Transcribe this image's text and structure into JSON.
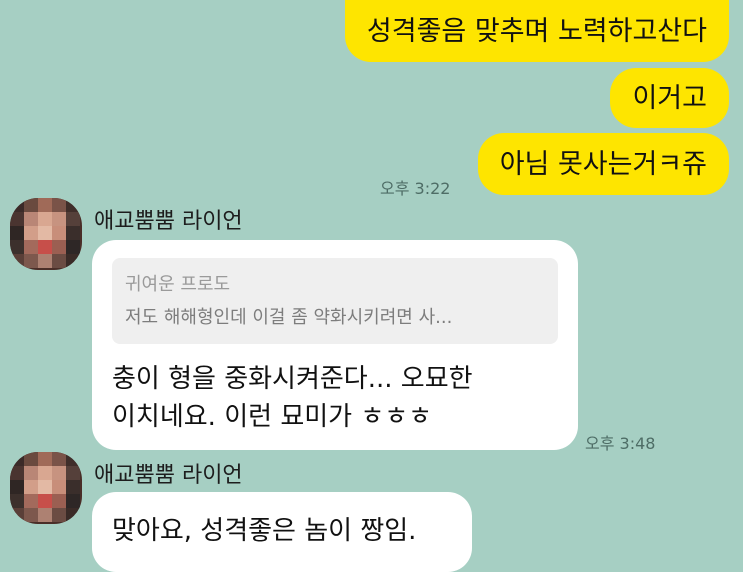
{
  "messages": {
    "sent": [
      {
        "text": "성격좋음 맞추며 노력하고산다"
      },
      {
        "text": "이거고"
      },
      {
        "text": "아님 못사는거ㅋ쥬"
      }
    ],
    "sent_time": "오후 3:22",
    "received_1": {
      "sender": "애교뿜뿜 라이언",
      "reply_to_name": "귀여운 프로도",
      "reply_to_text": "저도 해해형인데 이걸 좀 약화시키려면 사...",
      "lines": [
        "충이 형을 중화시켜준다... 오묘한",
        "이치네요. 이런 묘미가 ㅎㅎㅎ"
      ],
      "time": "오후 3:48"
    },
    "received_2": {
      "sender": "애교뿜뿜 라이언",
      "text": "맞아요, 성격좋은 놈이 짱임."
    }
  },
  "colors": {
    "background": "#a6cfc3",
    "sent_bubble": "#fee500",
    "received_bubble": "#ffffff",
    "quote_box": "#efefef"
  },
  "avatar_icon": "blurred-profile-photo"
}
